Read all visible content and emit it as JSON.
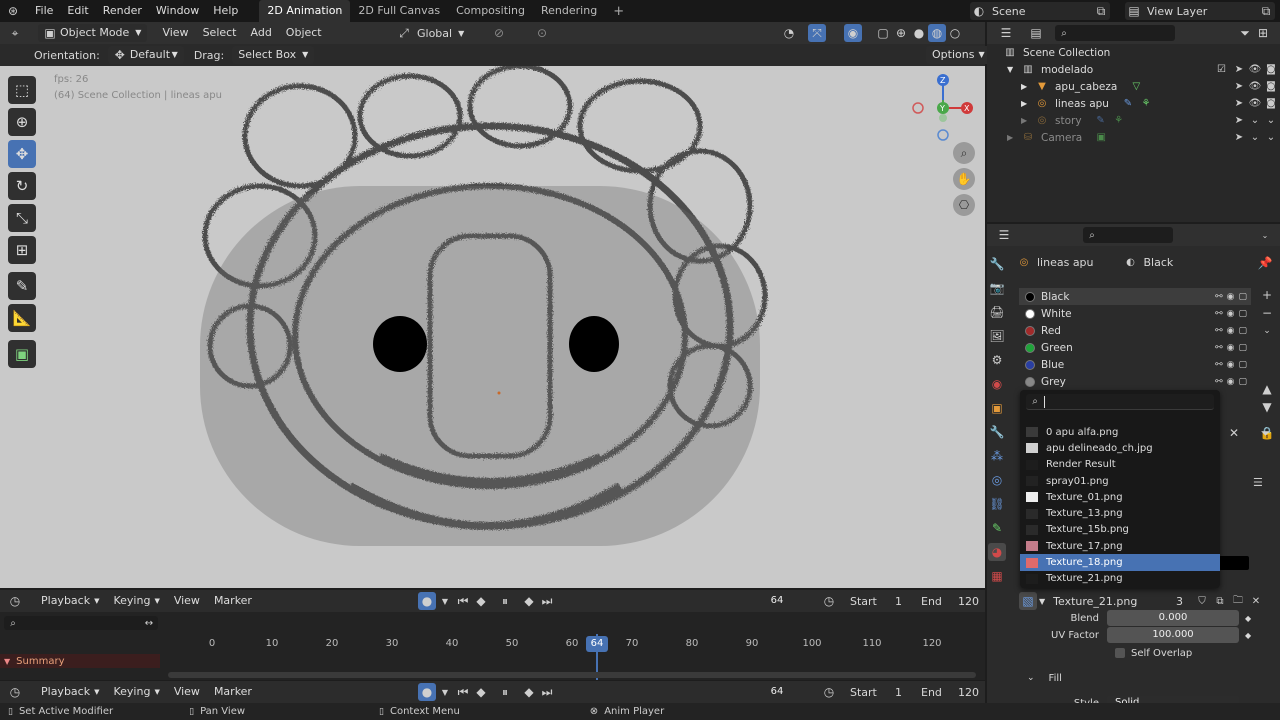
{
  "topbar": {
    "menus": [
      "File",
      "Edit",
      "Render",
      "Window",
      "Help"
    ],
    "workspaces": [
      "2D Animation",
      "2D Full Canvas",
      "Compositing",
      "Rendering"
    ],
    "add_tab": "+",
    "scene_label": "Scene",
    "view_layer_label": "View Layer"
  },
  "viewport_header": {
    "mode": "Object Mode",
    "menus": [
      "View",
      "Select",
      "Add",
      "Object"
    ],
    "transform": "Global"
  },
  "tool_header": {
    "orientation_label": "Orientation:",
    "orientation_value": "Default",
    "drag_label": "Drag:",
    "drag_value": "Select Box",
    "options": "Options"
  },
  "viewport": {
    "overlay_fps": "fps: 26",
    "overlay_info": "(64) Scene Collection | lineas apu",
    "gizmo_axes": [
      "Z",
      "Y",
      "X"
    ]
  },
  "outliner": {
    "root": "Scene Collection",
    "rows": [
      {
        "label": "modelado",
        "color": "#e0e0e0"
      },
      {
        "label": "apu_cabeza",
        "color": "#e0e0e0"
      },
      {
        "label": "lineas apu",
        "color": "#e0e0e0"
      },
      {
        "label": "story",
        "color": "#8a8a8a"
      },
      {
        "label": "Camera",
        "color": "#8a8a8a"
      }
    ]
  },
  "properties": {
    "object": "lineas apu",
    "material": "Black",
    "materials": [
      {
        "label": "Black",
        "dot": "#000000"
      },
      {
        "label": "White",
        "dot": "#ffffff"
      },
      {
        "label": "Red",
        "dot": "#a22a2a"
      },
      {
        "label": "Green",
        "dot": "#1fa33a"
      },
      {
        "label": "Blue",
        "dot": "#2a3fa2"
      },
      {
        "label": "Grey",
        "dot": "#888888"
      }
    ],
    "texture_field": "Texture_21.png",
    "texture_users": "3",
    "blend_label": "Blend",
    "blend_value": "0.000",
    "uv_label": "UV Factor",
    "uv_value": "100.000",
    "self_overlap": "Self Overlap",
    "fill_label": "Fill",
    "style_label": "Style",
    "style_value": "Solid"
  },
  "image_dropdown": {
    "search_placeholder": "",
    "items": [
      {
        "label": "0 apu alfa.png",
        "swatch": "#3a3a3a"
      },
      {
        "label": "apu delineado_ch.jpg",
        "swatch": "#cfcfcf"
      },
      {
        "label": "Render Result",
        "swatch": "#1d1d1d"
      },
      {
        "label": "spray01.png",
        "swatch": "#222222"
      },
      {
        "label": "Texture_01.png",
        "swatch": "#eeeeee"
      },
      {
        "label": "Texture_13.png",
        "swatch": "#2a2a2a"
      },
      {
        "label": "Texture_15b.png",
        "swatch": "#2a2a2a"
      },
      {
        "label": "Texture_17.png",
        "swatch": "#c47c8a"
      },
      {
        "label": "Texture_18.png",
        "swatch": "#e06a6a"
      },
      {
        "label": "Texture_21.png",
        "swatch": "#1d1d1d"
      }
    ],
    "selected_index": 8
  },
  "timeline": {
    "menus": [
      "Playback",
      "Keying",
      "View",
      "Marker"
    ],
    "current_frame": "64",
    "start_label": "Start",
    "start_value": "1",
    "end_label": "End",
    "end_value": "120",
    "ticks": [
      "0",
      "10",
      "20",
      "30",
      "40",
      "50",
      "60",
      "70",
      "80",
      "90",
      "100",
      "110",
      "120"
    ],
    "playhead_label": "64",
    "summary": "Summary"
  },
  "statusbar": {
    "items": [
      "Set Active Modifier",
      "Pan View",
      "Context Menu",
      "Anim Player"
    ]
  }
}
